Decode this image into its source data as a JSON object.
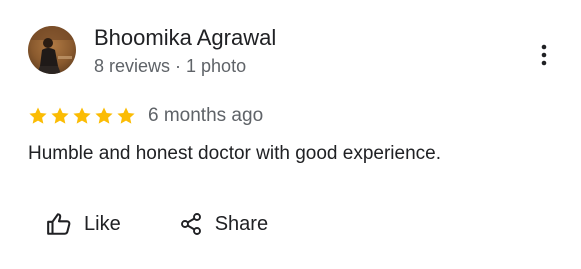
{
  "review": {
    "author_name": "Bhoomika Agrawal",
    "author_meta": "8 reviews · 1 photo",
    "rating": 5,
    "rating_max": 5,
    "date": "6 months ago",
    "text": "Humble and honest doctor with good experience."
  },
  "actions": {
    "like_label": "Like",
    "share_label": "Share"
  },
  "icons": {
    "avatar": "avatar-photo",
    "more": "more-vert-icon",
    "star": "star-icon",
    "like": "thumb-up-icon",
    "share": "share-icon"
  },
  "colors": {
    "star": "#FBBC04",
    "text_primary": "#202124",
    "text_secondary": "#5f6368"
  }
}
